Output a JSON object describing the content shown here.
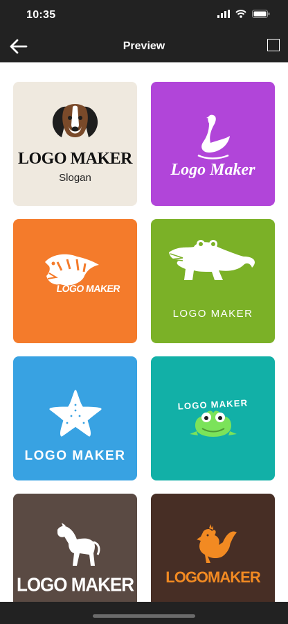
{
  "status_bar": {
    "time": "10:35"
  },
  "nav": {
    "title": "Preview"
  },
  "cards": [
    {
      "name": "Dog",
      "line1": "LOGO MAKER",
      "line2": "Slogan",
      "bg": "#efe9df"
    },
    {
      "name": "Swan",
      "line1": "Logo Maker",
      "bg": "#b145d9"
    },
    {
      "name": "Tiger",
      "line1": "LOGO MAKER",
      "bg": "#f47b2b"
    },
    {
      "name": "Crocodile",
      "line1": "LOGO MAKER",
      "bg": "#7bb127"
    },
    {
      "name": "Starfish",
      "line1": "LOGO MAKER",
      "bg": "#38a2e2"
    },
    {
      "name": "Frog",
      "line1": "LOGO MAKER",
      "bg": "#12b0a7"
    },
    {
      "name": "Horse",
      "line1": "LOGO MAKER",
      "bg": "#5a4a43"
    },
    {
      "name": "Rooster",
      "line1": "LOGOMAKER",
      "bg": "#472e25"
    }
  ],
  "colors": {
    "bars": "#222222",
    "frog_green": "#7be35a",
    "rooster_orange": "#f28a22"
  },
  "icons": [
    "back-arrow-icon",
    "square-icon",
    "signal-icon",
    "wifi-icon",
    "battery-icon"
  ]
}
